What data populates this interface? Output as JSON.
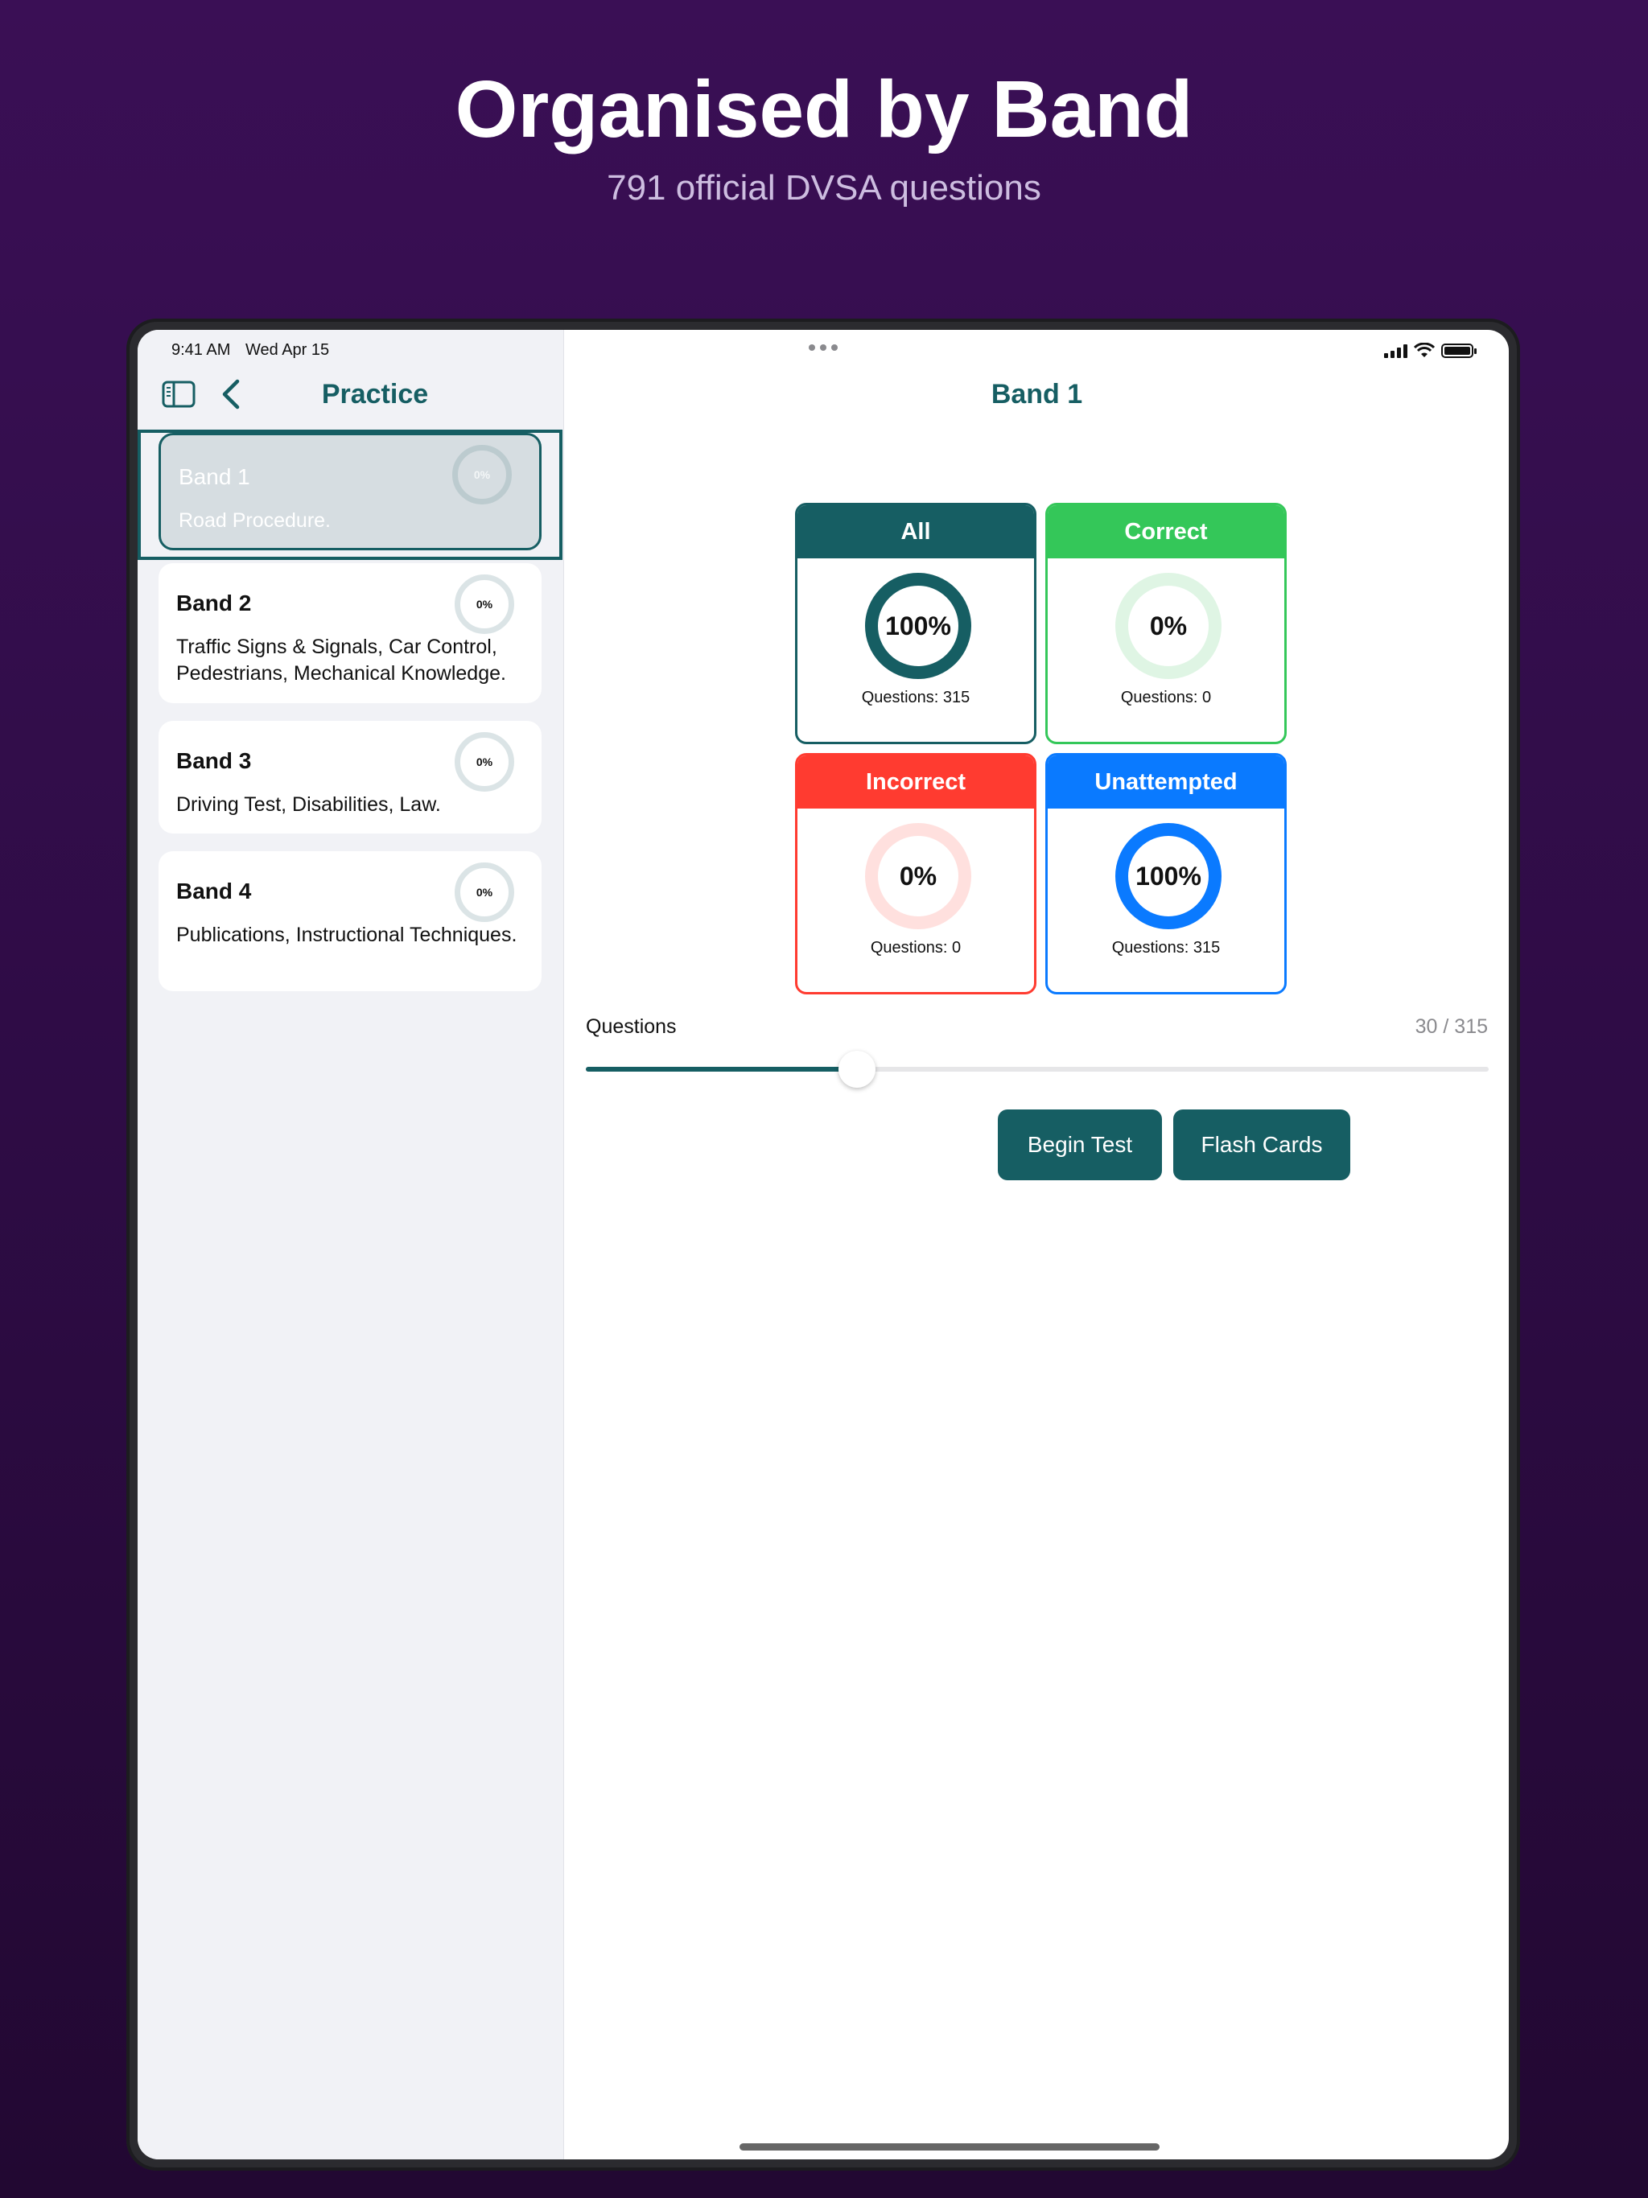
{
  "hero": {
    "title": "Organised by Band",
    "subtitle": "791 official DVSA questions"
  },
  "status_bar": {
    "time": "9:41 AM",
    "date": "Wed Apr 15",
    "icons": [
      "signal-icon",
      "wifi-icon",
      "battery-icon"
    ]
  },
  "sidebar": {
    "title": "Practice",
    "bands": [
      {
        "title": "Band 1",
        "description": "Road Procedure.",
        "progress": "0%",
        "selected": true
      },
      {
        "title": "Band 2",
        "description": "Traffic Signs & Signals, Car Control, Pedestrians, Mechanical Knowledge.",
        "progress": "0%",
        "selected": false
      },
      {
        "title": "Band 3",
        "description": "Driving Test, Disabilities, Law.",
        "progress": "0%",
        "selected": false
      },
      {
        "title": "Band 4",
        "description": "Publications, Instructional Techniques.",
        "progress": "0%",
        "selected": false
      }
    ]
  },
  "main": {
    "title": "Band 1",
    "stats": [
      {
        "label": "All",
        "percent": "100%",
        "count": "Questions: 315",
        "color": "#165e63",
        "light": "#165e63"
      },
      {
        "label": "Correct",
        "percent": "0%",
        "count": "Questions: 0",
        "color": "#34c759",
        "light": "#dff5e4"
      },
      {
        "label": "Incorrect",
        "percent": "0%",
        "count": "Questions: 0",
        "color": "#ff3b30",
        "light": "#ffe0de"
      },
      {
        "label": "Unattempted",
        "percent": "100%",
        "count": "Questions: 315",
        "color": "#0a7aff",
        "light": "#0a7aff"
      }
    ],
    "questions_label": "Questions",
    "questions_value": "30 / 315",
    "slider_fraction": 0.3,
    "begin_test_label": "Begin Test",
    "flash_cards_label": "Flash Cards"
  },
  "colors": {
    "accent": "#165e63",
    "background": "#3a0f55"
  }
}
